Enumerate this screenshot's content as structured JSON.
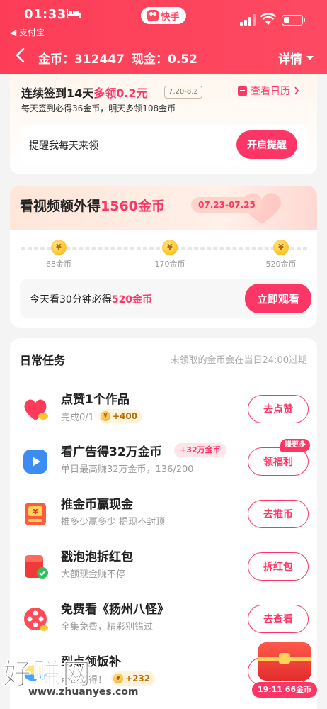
{
  "status_bar": {
    "time": "01:33",
    "back_app": "◀ 支付宝",
    "center_app": "快手"
  },
  "nav": {
    "coins_label": "金币：312447",
    "cash_label": "现金：0.52",
    "detail_label": "详情"
  },
  "signin": {
    "title_prefix": "连续签到14天",
    "title_highlight": "多领0.2元",
    "date_range": "7.20-8.2",
    "subtitle": "每天签到必得36金币，明天多领108金币",
    "calendar_link": "查看日历",
    "remind_label": "提醒我每天来领",
    "remind_button": "开启提醒"
  },
  "video_bonus": {
    "title_prefix": "看视频额外得",
    "title_highlight": "1560金币",
    "date_range": "07.23-07.25",
    "milestones": [
      {
        "label": "68金币",
        "coin_glyph": "¥"
      },
      {
        "label": "170金币",
        "coin_glyph": "¥"
      },
      {
        "label": "520金币",
        "coin_glyph": "¥"
      }
    ],
    "watch_prefix": "今天看30分钟必得",
    "watch_highlight": "520金币",
    "watch_button": "立即观看"
  },
  "daily_tasks": {
    "title": "日常任务",
    "note": "未领取的金币会在当日24:00过期",
    "items": [
      {
        "name": "点赞1个作品",
        "sub": "完成0/1",
        "coins": "+400",
        "button": "去点赞",
        "icon": "heart-icon"
      },
      {
        "name": "看广告得32万金币",
        "sub": "单日最高赚32万金币，136/200",
        "reward_tag": "+32万金币",
        "badge": "赚更多",
        "button": "领福利",
        "icon": "play-icon"
      },
      {
        "name": "推金币赢现金",
        "sub": "推多少赢多少 提现不封顶",
        "button": "去推币",
        "icon": "coin-pusher-icon"
      },
      {
        "name": "戳泡泡拆红包",
        "sub": "大额现金赚不停",
        "button": "拆红包",
        "icon": "red-envelope-icon"
      },
      {
        "name": "免费看《扬州八怪》",
        "sub": "全集免费，精彩别错过",
        "button": "去查看",
        "icon": "film-reel-icon"
      },
      {
        "name": "到点领饭补",
        "sub": "点击立得！",
        "coins": "+232",
        "button": "去领取",
        "icon": "meal-icon"
      }
    ]
  },
  "floating": {
    "timer": "19:11 66金币"
  },
  "watermark": {
    "brand": "好赚网",
    "url": "www.zhuanyes.com"
  },
  "colors": {
    "accent": "#fe3666",
    "header": "#fd3d57",
    "gold": "#ffc733"
  }
}
